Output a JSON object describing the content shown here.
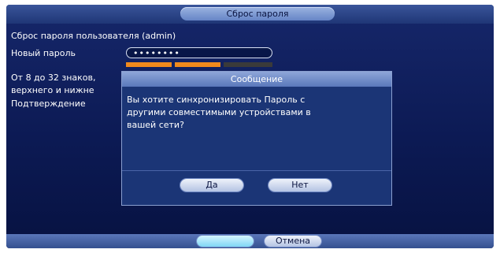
{
  "dialog": {
    "title": "Сброс пароля",
    "reset_for_user": "Сброс пароля пользователя (admin)",
    "new_password_label": "Новый пароль",
    "new_password_value": "••••••••",
    "hint_line1": "От 8 до 32 знаков,",
    "hint_line2": "верхнего и нижне",
    "confirm_label": "Подтверждение",
    "password_strength_segments_filled": 2,
    "password_strength_segments_total": 3
  },
  "message": {
    "title": "Сообщение",
    "text_line1": "Вы хотите синхронизировать Пароль с",
    "text_line2": "другими совместимыми устройствами в",
    "text_line3": "вашей сети?",
    "yes_label": "Да",
    "no_label": "Нет"
  },
  "footer": {
    "cancel_label": "Отмена"
  },
  "colors": {
    "panel": "#0c1a54",
    "strength_fill": "#f08a1c",
    "strength_empty": "#3a3a3a",
    "highlight_button": "#a8e8ff"
  }
}
